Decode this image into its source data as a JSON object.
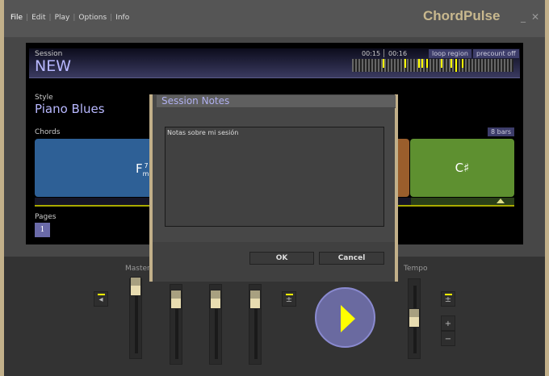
{
  "menu": [
    "File",
    "Edit",
    "Play",
    "Options",
    "Info"
  ],
  "app_title": "ChordPulse",
  "window_controls": {
    "minimize": "_",
    "close": "✕"
  },
  "session": {
    "label": "Session",
    "name": "NEW",
    "time_elapsed": "00:15",
    "time_total": "00:16",
    "loop_region": "loop region",
    "precount": "precount off"
  },
  "style": {
    "label": "Style",
    "name": "Piano Blues"
  },
  "chords": {
    "label": "Chords",
    "bars": "8 bars",
    "items": [
      {
        "root": "F",
        "quality": "m",
        "ext": "7",
        "color": "#2e6096"
      },
      {
        "root": "",
        "color": "#9a5e2c"
      },
      {
        "root": "C♯",
        "color": "#5e9030"
      }
    ]
  },
  "pages": {
    "label": "Pages",
    "current": "1"
  },
  "dialog": {
    "title": "Session Notes",
    "notes": "Notas sobre mi sesión",
    "ok": "OK",
    "cancel": "Cancel"
  },
  "mixer": {
    "master_label": "Master",
    "tempo_label": "Tempo",
    "plus": "+",
    "minus": "−"
  },
  "colors": {
    "accent": "#b8b8ff",
    "play": "#6a6aa0",
    "brand": "#c8b88e"
  }
}
